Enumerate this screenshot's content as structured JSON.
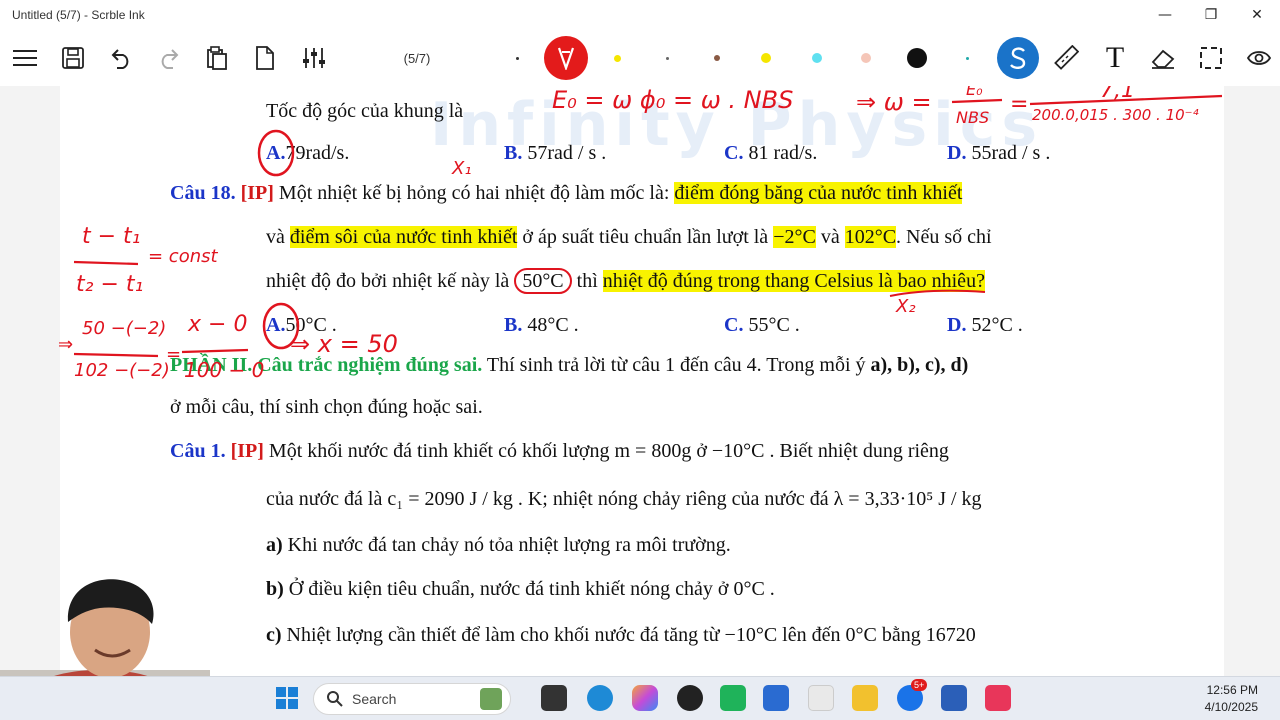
{
  "window": {
    "title": "Untitled (5/7) - Scrble Ink",
    "minimize": "—",
    "maximize": "❐",
    "close": "✕"
  },
  "toolbar": {
    "page_indicator": "(5/7)",
    "icons": [
      "menu-icon",
      "save-icon",
      "undo-icon",
      "redo-icon",
      "clipboard-icon",
      "new-page-icon",
      "settings-sliders-icon",
      "pen-icon",
      "s-pen-icon",
      "ruler-icon",
      "text-tool-icon",
      "eraser-icon",
      "selection-icon",
      "view-icon"
    ],
    "text_tool_label": "T",
    "colors": {
      "active_pen": "#e31b1b",
      "yellow": "#f5e600",
      "brown": "#8a5a44",
      "cyan": "#5fe0f0",
      "peach": "#f5c6b8",
      "black": "#111111",
      "blue_tool": "#1a73c9"
    }
  },
  "document": {
    "watermark": "Infinity Physics",
    "q17": {
      "stem": "Tốc độ góc của khung là",
      "options": [
        {
          "label": "A.",
          "text": "79rad/s."
        },
        {
          "label": "B.",
          "text": "57rad / s ."
        },
        {
          "label": "C.",
          "text": "81 rad/s."
        },
        {
          "label": "D.",
          "text": "55rad / s ."
        }
      ]
    },
    "q18": {
      "number": "Câu 18.",
      "tag": "[IP]",
      "line1_plain": "Một nhiệt kế bị hỏng có hai nhiệt độ làm mốc là:",
      "line1_hl": "điểm đóng băng của nước tinh khiết",
      "line2_pre": "và",
      "line2_hl": "điểm sôi của nước tinh khiết",
      "line2_mid": "ở áp suất tiêu chuẩn lần lượt là",
      "val1": "−2°C",
      "and": "và",
      "val2": "102°C",
      "line2_end": ". Nếu số chỉ",
      "line3_pre": "nhiệt độ đo bởi nhiệt kế này là",
      "val3": "50°C",
      "line3_mid": "thì",
      "line3_hl": "nhiệt độ đúng trong thang Celsius là bao nhiêu?",
      "options": [
        {
          "label": "A.",
          "text": "50°C ."
        },
        {
          "label": "B.",
          "text": "48°C ."
        },
        {
          "label": "C.",
          "text": "55°C ."
        },
        {
          "label": "D.",
          "text": "52°C ."
        }
      ]
    },
    "part2": {
      "title": "PHẦN II. Câu trắc nghiệm đúng sai.",
      "text": "Thí sinh trả lời từ câu 1 đến câu 4. Trong mỗi ý",
      "bold_items": "a), b), c), d)",
      "line2": "ở mỗi câu, thí sinh chọn đúng hoặc sai."
    },
    "c1": {
      "number": "Câu 1.",
      "tag": "[IP]",
      "line1": "Một khối nước đá tinh khiết có khối lượng  m = 800g  ở  −10°C . Biết nhiệt dung riêng",
      "line2": "của nước đá là  c₁ = 2090 J / kg . K; nhiệt nóng chảy riêng của nước đá  λ = 3,33·10⁵ J / kg",
      "a_label": "a)",
      "a_text": "Khi nước đá tan chảy nó tỏa nhiệt lượng ra môi trường.",
      "b_label": "b)",
      "b_text": "Ở điều kiện tiêu chuẩn, nước đá tinh khiết nóng chảy ở 0°C .",
      "c_label": "c)",
      "c_text": "Nhiệt lượng cần thiết để làm cho khối nước đá tăng từ  −10°C  lên đến  0°C  bằng 16720"
    },
    "ink": {
      "eq_top": "E₀ = ω ϕ₀ = ω . NBS",
      "eq_omega": "⇒ ω =",
      "frac1_num": "E₀",
      "frac1_den": "NBS",
      "eq_eq": "=",
      "frac2_num": "7,1",
      "frac2_den": "200.0,015 . 300 . 10⁻⁴",
      "x1": "X₁",
      "x2": "X₂",
      "left_num": "t − t₁",
      "left_den": "t₂ − t₁",
      "const": "= const",
      "arrow": "⇒",
      "f3_num": "50 −(−2)",
      "f3_den": "102 −(−2)",
      "f4_num": "x − 0",
      "f4_den": "100 − 0",
      "result": "⇒ x = 50"
    }
  },
  "taskbar": {
    "search_placeholder": "Search",
    "time": "12:56 PM",
    "date": "4/10/2025",
    "badge": "5+"
  }
}
